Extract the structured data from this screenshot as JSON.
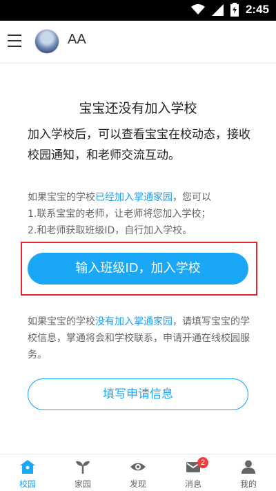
{
  "status_bar": {
    "time": "2:45"
  },
  "header": {
    "username": "AA"
  },
  "main": {
    "title": "宝宝还没有加入学校",
    "intro": "加入学校后，可以查看宝宝在校动态，接收校园通知，和老师交流互动。",
    "joined": {
      "prefix": "如果宝宝的学校",
      "highlight": "已经加入掌通家园",
      "suffix": "，您可以",
      "step1": "1.联系宝宝的老师，让老师将您加入学校；",
      "step2": "2.和老师获取班级ID，自行加入学校。"
    },
    "join_button": "输入班级ID，加入学校",
    "not_joined": {
      "prefix": "如果宝宝的学校",
      "highlight": "没有加入掌通家园",
      "suffix": "，请填写宝宝的学校信息，掌通将会和学校联系，申请开通在线校园服务。"
    },
    "apply_button": "填写申请信息"
  },
  "tabbar": {
    "items": [
      {
        "label": "校园",
        "icon": "school-icon",
        "active": true
      },
      {
        "label": "家园",
        "icon": "sprout-icon"
      },
      {
        "label": "发现",
        "icon": "eye-icon"
      },
      {
        "label": "消息",
        "icon": "message-icon",
        "badge": "2"
      },
      {
        "label": "我的",
        "icon": "profile-icon"
      }
    ]
  },
  "colors": {
    "accent": "#1aa7f5",
    "highlight_border": "#e0262e",
    "badge": "#f23b3b"
  }
}
